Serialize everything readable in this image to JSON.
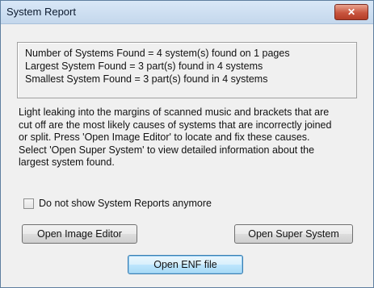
{
  "window": {
    "title": "System Report",
    "close_glyph": "✕",
    "close_icon": "close-icon"
  },
  "summary": {
    "lines": [
      "Number of Systems Found = 4  system(s) found on 1 pages",
      "Largest System Found = 3 part(s) found in 4 systems",
      "Smallest System Found = 3 part(s) found in 4 systems"
    ]
  },
  "info": {
    "lines": [
      "Light leaking into the margins of scanned music and brackets that are",
      "cut off are the most likely causes of systems that are incorrectly joined",
      "or split. Press 'Open Image Editor' to locate and fix these causes.",
      "Select 'Open Super System' to view detailed information about the",
      "largest system found."
    ]
  },
  "checkbox": {
    "label": "Do not show System Reports anymore",
    "checked": false
  },
  "buttons": {
    "open_image_editor": "Open Image Editor",
    "open_super_system": "Open Super System",
    "open_enf_file": "Open ENF file"
  }
}
